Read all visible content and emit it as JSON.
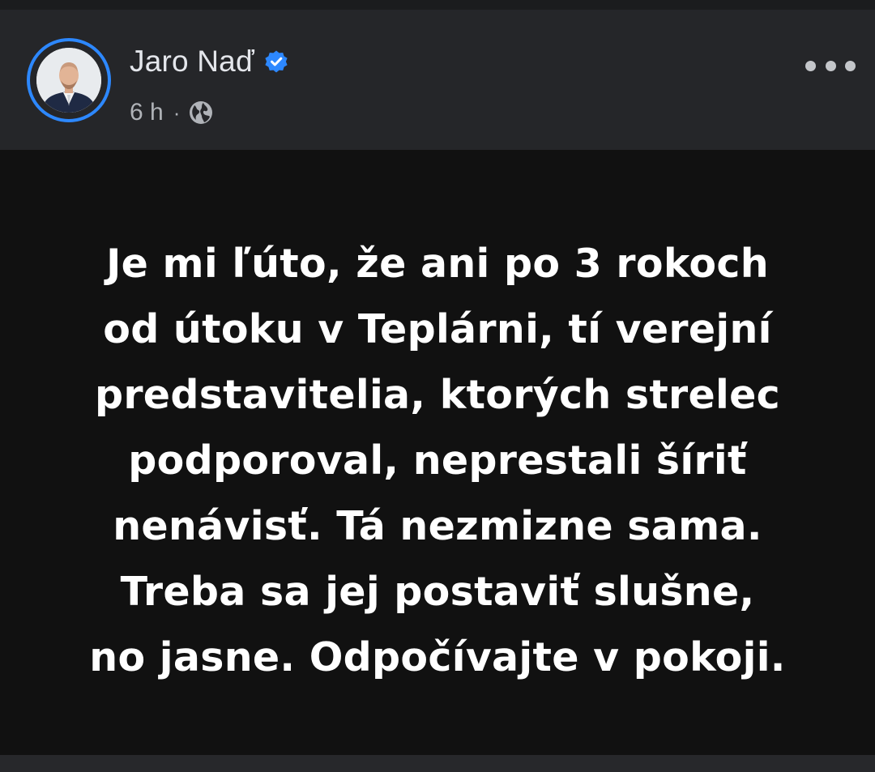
{
  "post": {
    "author": "Jaro Naď",
    "verified": true,
    "time": "6 h",
    "separator": "·",
    "audience_icon": "globe-icon",
    "menu_icon": "more-options-icon",
    "text_lines": [
      "Je mi ľúto, že ani po 3 rokoch",
      "od útoku v Teplárni, tí verejní",
      "predstavitelia, ktorých strelec",
      "podporoval, neprestali šíriť",
      "nenávisť. Tá nezmizne sama.",
      "Treba sa jej postaviť slušne,",
      "no jasne. Odpočívajte v pokoji."
    ]
  },
  "colors": {
    "header_bg": "#252629",
    "post_bg": "#111111",
    "avatar_ring": "#2d88ff",
    "verified_badge": "#2d88ff",
    "name_text": "#e4e6eb",
    "meta_text": "#b0b3b8",
    "post_text": "#ffffff"
  }
}
